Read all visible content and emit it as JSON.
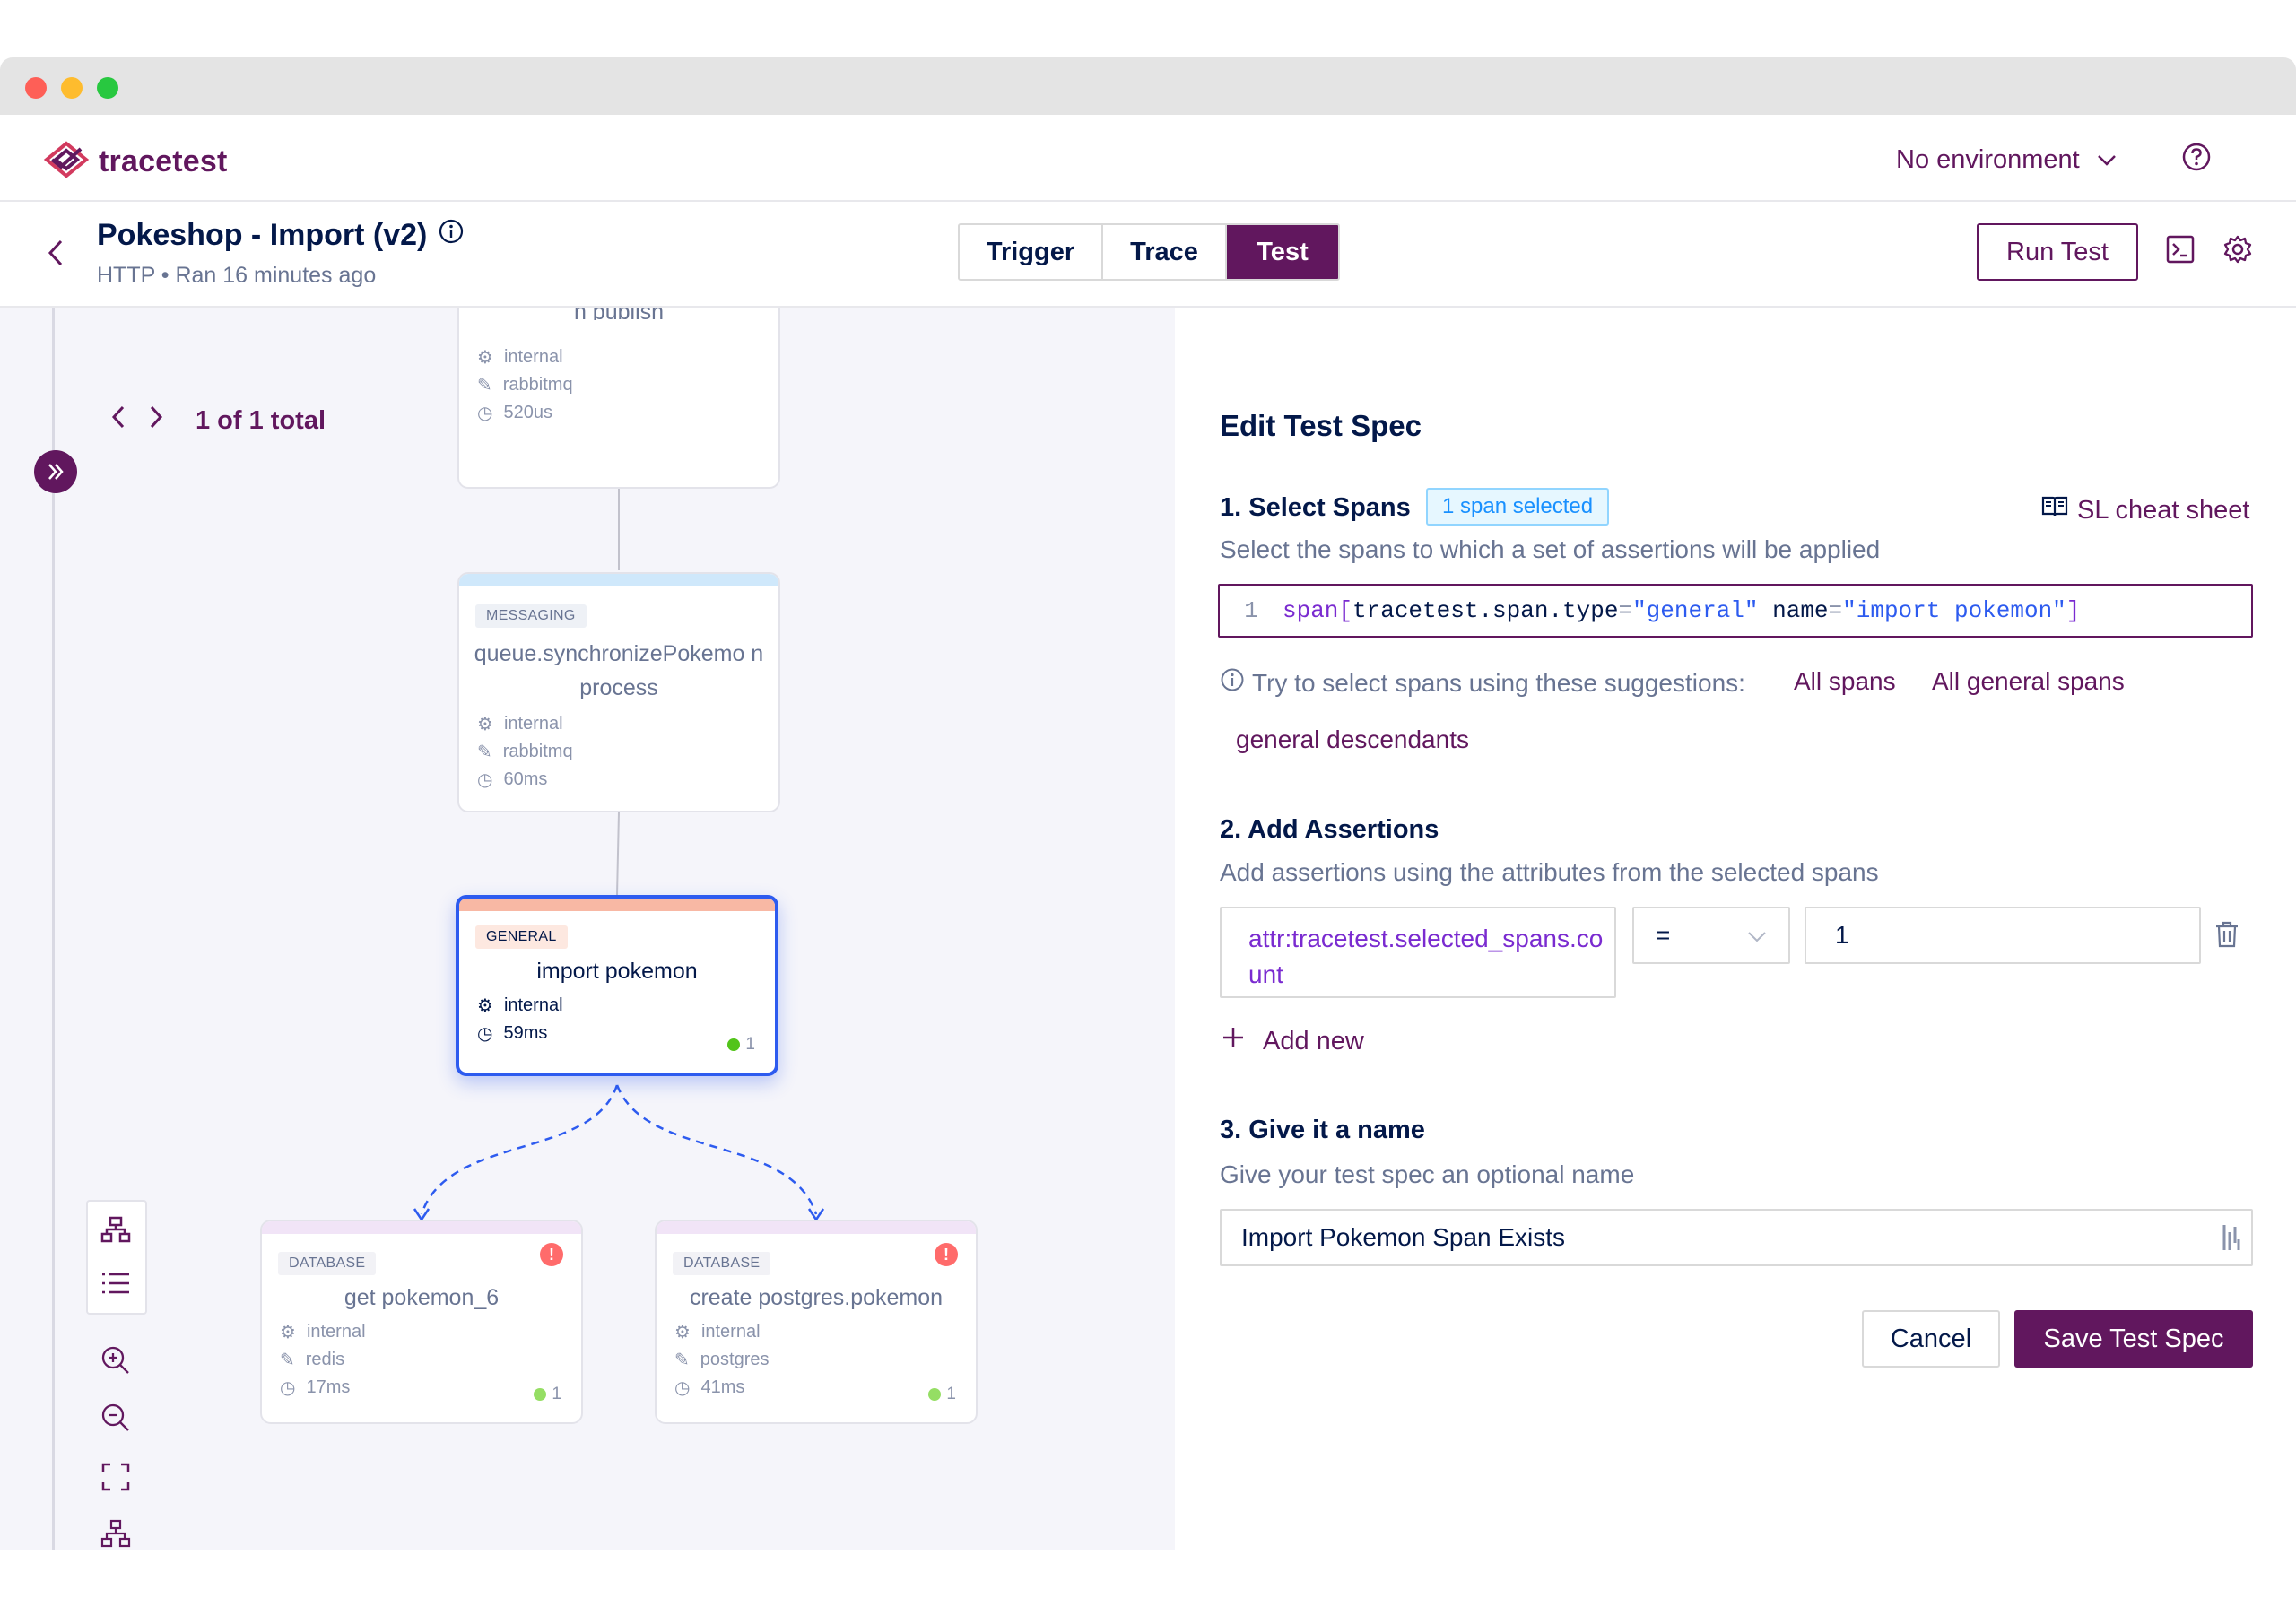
{
  "app": {
    "logo_text": "tracetest",
    "environment": "No environment"
  },
  "test": {
    "title": "Pokeshop - Import (v2)",
    "subtitle": "HTTP • Ran 16 minutes ago"
  },
  "tabs": [
    {
      "label": "Trigger",
      "active": false
    },
    {
      "label": "Trace",
      "active": false
    },
    {
      "label": "Test",
      "active": true
    }
  ],
  "header": {
    "run_test_label": "Run Test"
  },
  "pager": {
    "text": "1 of 1 total"
  },
  "nodes": {
    "publish": {
      "name_tail": "n publish",
      "kind_meta": "internal",
      "system": "rabbitmq",
      "duration": "520us"
    },
    "sync": {
      "kind": "MESSAGING",
      "name": "queue.synchronizePokemo n process",
      "kind_meta": "internal",
      "system": "rabbitmq",
      "duration": "60ms"
    },
    "import": {
      "kind": "GENERAL",
      "name": "import pokemon",
      "kind_meta": "internal",
      "duration": "59ms",
      "passed": "1"
    },
    "get": {
      "kind": "DATABASE",
      "name": "get pokemon_6",
      "kind_meta": "internal",
      "system": "redis",
      "duration": "17ms",
      "passed": "1",
      "error": "!"
    },
    "create": {
      "kind": "DATABASE",
      "name": "create postgres.pokemon",
      "kind_meta": "internal",
      "system": "postgres",
      "duration": "41ms",
      "passed": "1",
      "error": "!"
    }
  },
  "spec": {
    "title": "Edit Test Spec",
    "step1": {
      "title": "1. Select Spans",
      "badge": "1 span selected",
      "cheat_sheet": "SL cheat sheet",
      "desc": "Select the spans to which a set of assertions will be applied"
    },
    "selector": {
      "line_no": "1",
      "tokens": {
        "t1": "span[",
        "t2": "tracetest.span.type",
        "t3": "=",
        "t4": "\"general\"",
        "t5": " name",
        "t6": "=",
        "t7": "\"import pokemon\"",
        "t8": "]"
      }
    },
    "suggestions": {
      "label": "Try to select spans using these suggestions:",
      "items": [
        "All spans",
        "All general spans",
        "general descendants"
      ]
    },
    "step2": {
      "title": "2. Add Assertions",
      "desc": "Add assertions using the attributes from the selected spans"
    },
    "assertion": {
      "attribute": "attr:tracetest.selected_spans.count",
      "operator": "=",
      "value": "1"
    },
    "add_new": "Add new",
    "step3": {
      "title": "3. Give it a name",
      "desc": "Give your test spec an optional name"
    },
    "name_value": "Import Pokemon Span Exists",
    "cancel": "Cancel",
    "save": "Save Test Spec"
  },
  "colors": {
    "brand": "#61175e",
    "text": "#031849",
    "muted": "#687492",
    "selected_border": "#2d5bef",
    "badge_blue": "#1890ff",
    "error": "#ff6b6b",
    "success": "#52c41a"
  },
  "icons": [
    "tracetest-logo-icon",
    "chevron-down-icon",
    "help-icon",
    "back-arrow-icon",
    "info-icon",
    "terminal-icon",
    "gear-icon",
    "expand-sidebar-icon",
    "prev-icon",
    "next-icon",
    "graph-view-icon",
    "list-view-icon",
    "zoom-in-icon",
    "zoom-out-icon",
    "fit-view-icon",
    "tree-icon",
    "book-icon",
    "plus-icon",
    "trash-icon",
    "clock-icon",
    "cog-icon",
    "wrench-icon"
  ]
}
